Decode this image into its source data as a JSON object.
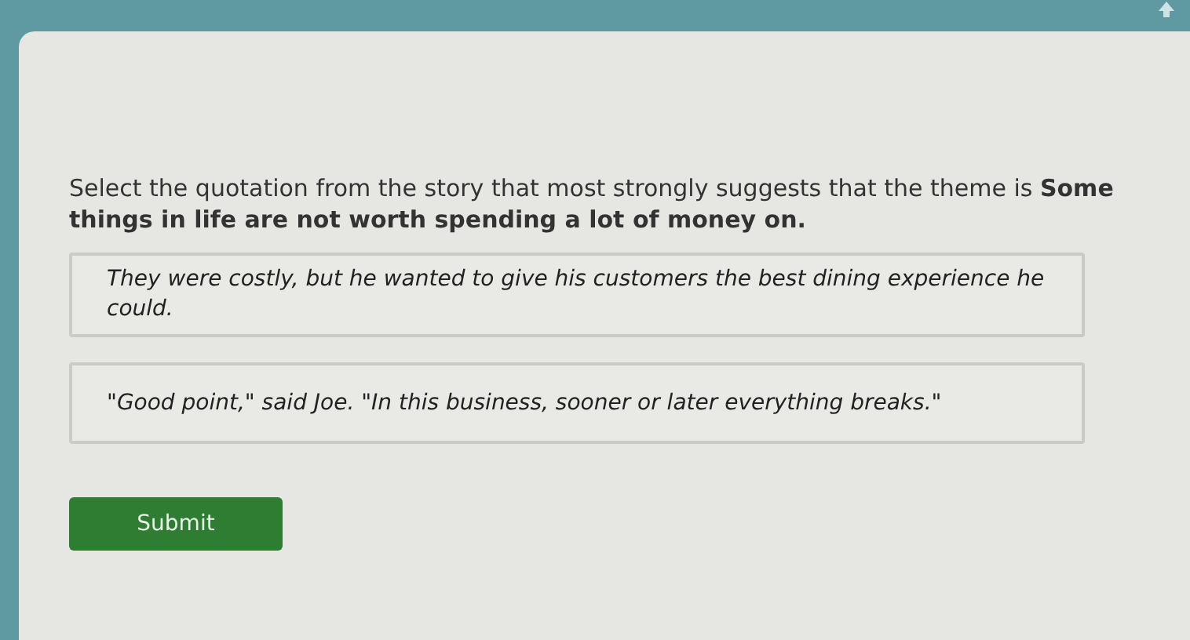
{
  "question": "Select the quotation from the story that most strongly suggests that the theme is **Some things in life are not worth spending a lot of money on.**",
  "options": [
    {
      "text": "They were costly, but he wanted to give his customers the best dining experience he could.",
      "selected": false
    },
    {
      "text": "\"Good point,\" said Joe. \"In this business, sooner or later everything breaks.\"",
      "selected": false
    }
  ],
  "submit": {
    "label": "Submit"
  }
}
